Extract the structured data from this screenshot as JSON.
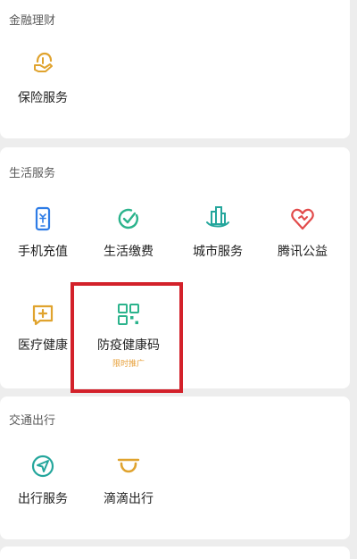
{
  "colors": {
    "background": "#ededed",
    "card": "#ffffff",
    "section_title": "#5b5b5b",
    "label": "#1f1f1f",
    "icon_gold": "#e0a32e",
    "icon_blue": "#2e7ce6",
    "icon_green": "#2bb38c",
    "icon_teal": "#24a69c",
    "icon_red": "#e24b4b",
    "highlight": "#d3212a",
    "sublabel": "#e7a03a"
  },
  "sections": {
    "finance": {
      "title": "金融理财",
      "items": [
        {
          "label": "保险服务",
          "icon": "umbrella-hand-icon"
        }
      ]
    },
    "life": {
      "title": "生活服务",
      "items": [
        {
          "label": "手机充值",
          "icon": "phone-icon"
        },
        {
          "label": "生活缴费",
          "icon": "check-circle-icon"
        },
        {
          "label": "城市服务",
          "icon": "city-icon"
        },
        {
          "label": "腾讯公益",
          "icon": "heart-icon"
        },
        {
          "label": "医疗健康",
          "icon": "medical-plus-icon"
        },
        {
          "label": "防疫健康码",
          "icon": "qr-code-icon",
          "sublabel": "限时推广"
        }
      ]
    },
    "transport": {
      "title": "交通出行",
      "items": [
        {
          "label": "出行服务",
          "icon": "navigation-icon"
        },
        {
          "label": "滴滴出行",
          "icon": "didi-icon"
        }
      ]
    }
  }
}
